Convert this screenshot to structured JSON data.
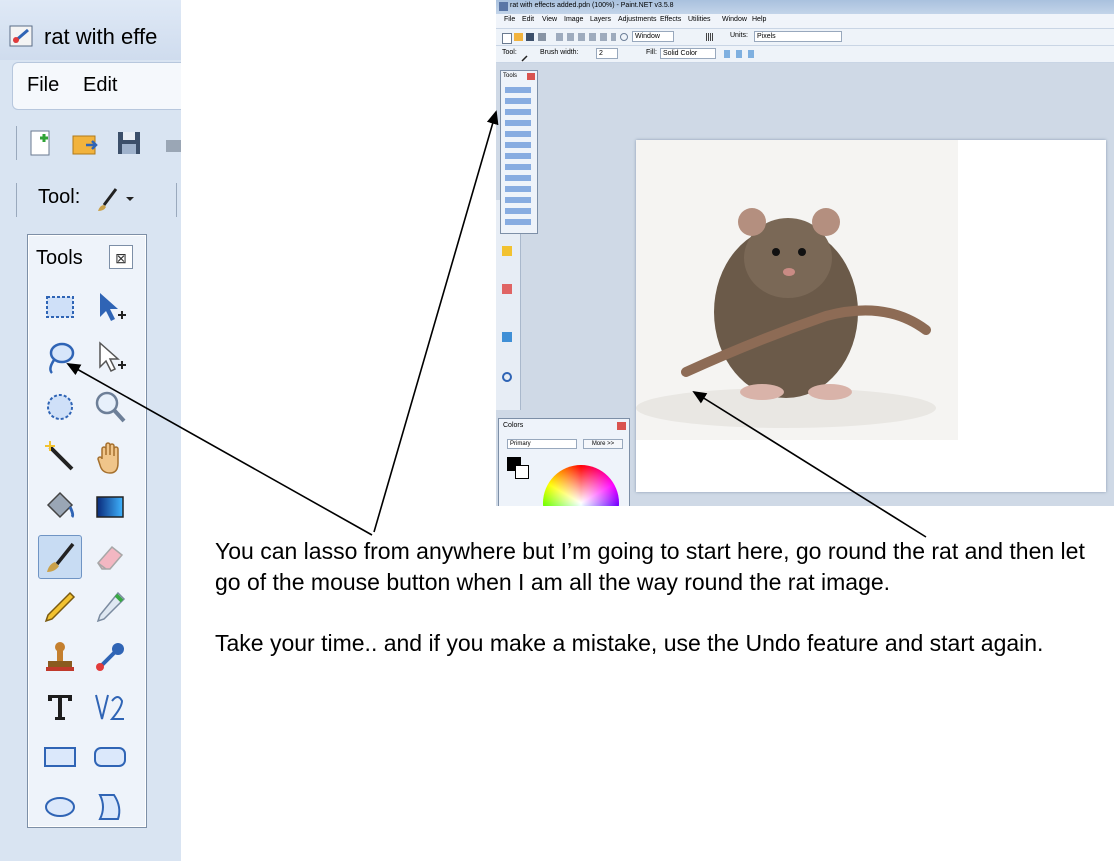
{
  "left_panel": {
    "title": "rat with effe",
    "menu": [
      "File",
      "Edit"
    ],
    "tool_label": "Tool:",
    "tools_window": {
      "title": "Tools",
      "close_glyph": "⊠",
      "items": [
        {
          "name": "rectangle-select-icon"
        },
        {
          "name": "move-selection-icon"
        },
        {
          "name": "lasso-select-icon"
        },
        {
          "name": "move-selected-icon"
        },
        {
          "name": "ellipse-select-icon"
        },
        {
          "name": "zoom-icon"
        },
        {
          "name": "magic-wand-icon"
        },
        {
          "name": "pan-hand-icon"
        },
        {
          "name": "paint-bucket-icon"
        },
        {
          "name": "gradient-icon"
        },
        {
          "name": "paintbrush-icon",
          "selected": true
        },
        {
          "name": "eraser-icon"
        },
        {
          "name": "pencil-icon"
        },
        {
          "name": "color-picker-icon"
        },
        {
          "name": "clone-stamp-icon"
        },
        {
          "name": "recolor-icon"
        },
        {
          "name": "text-icon"
        },
        {
          "name": "line-curve-icon"
        },
        {
          "name": "rectangle-shape-icon"
        },
        {
          "name": "rounded-rectangle-icon"
        },
        {
          "name": "ellipse-shape-icon"
        },
        {
          "name": "freeform-shape-icon"
        }
      ]
    }
  },
  "right_screenshot": {
    "title": "rat with effects added.pdn (100%) - Paint.NET v3.5.8",
    "menu": [
      "File",
      "Edit",
      "View",
      "Image",
      "Layers",
      "Adjustments",
      "Effects",
      "Utilities",
      "Window",
      "Help"
    ],
    "toolbar1": {
      "window_label": "Window",
      "units_label": "Units:",
      "units_value": "Pixels"
    },
    "toolbar2": {
      "tool_label": "Tool:",
      "brush_width_label": "Brush width:",
      "brush_width_value": "2",
      "fill_label": "Fill:",
      "fill_value": "Solid Color"
    },
    "tools_label": "Tools",
    "colors_window": {
      "title": "Colors",
      "primary": "Primary",
      "more": "More >>"
    }
  },
  "instructions": [
    "You can lasso from anywhere but I’m going to start here, go round the rat and then let go of the mouse button when I am all the way round the rat image.",
    "Take your time.. and if you make a mistake, use the Undo feature and start again."
  ],
  "colors": {
    "accent_blue": "#2f64b5",
    "canvas_bg": "#cfd9e6"
  }
}
